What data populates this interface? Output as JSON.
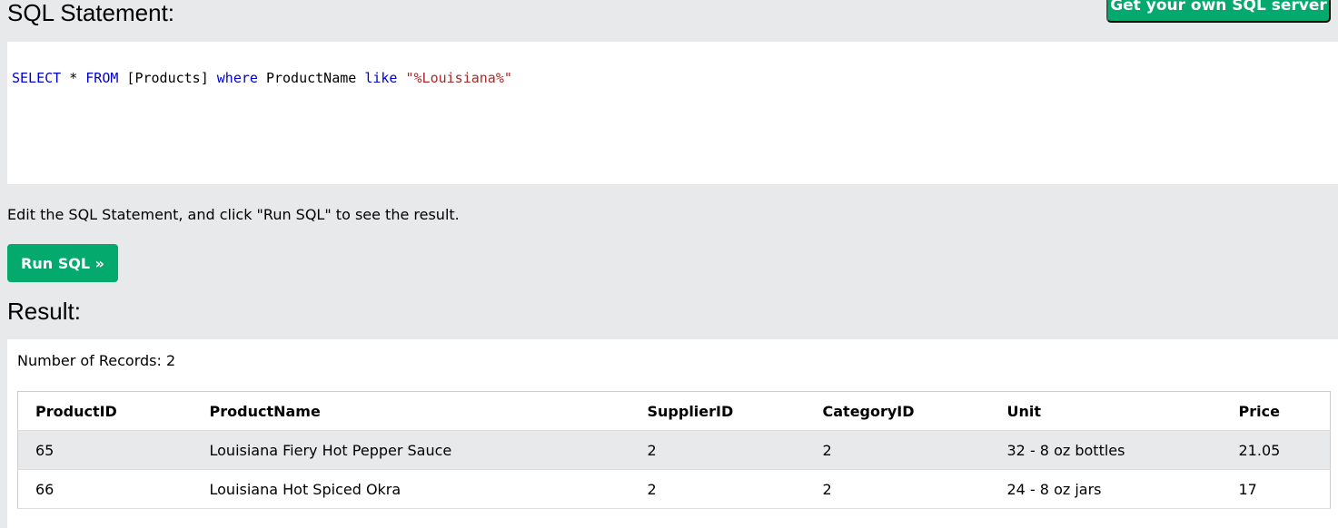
{
  "sql_title": "SQL Statement:",
  "get_server_label": "Get your own SQL server",
  "sql": {
    "t1": "SELECT",
    "t2": " * ",
    "t3": "FROM",
    "t4": " [Products] ",
    "t5": "where",
    "t6": " ProductName ",
    "t7": "like",
    "t8": " ",
    "t9": "\"%Louisiana%\""
  },
  "hint": "Edit the SQL Statement, and click \"Run SQL\" to see the result.",
  "run_label": "Run SQL »",
  "result_title": "Result:",
  "record_count": "Number of Records: 2",
  "table": {
    "headers": [
      "ProductID",
      "ProductName",
      "SupplierID",
      "CategoryID",
      "Unit",
      "Price"
    ],
    "rows": [
      [
        "65",
        "Louisiana Fiery Hot Pepper Sauce",
        "2",
        "2",
        "32 - 8 oz bottles",
        "21.05"
      ],
      [
        "66",
        "Louisiana Hot Spiced Okra",
        "2",
        "2",
        "24 - 8 oz jars",
        "17"
      ]
    ]
  },
  "colors": {
    "accent": "#04aa6d",
    "background": "#e7e9eb"
  }
}
